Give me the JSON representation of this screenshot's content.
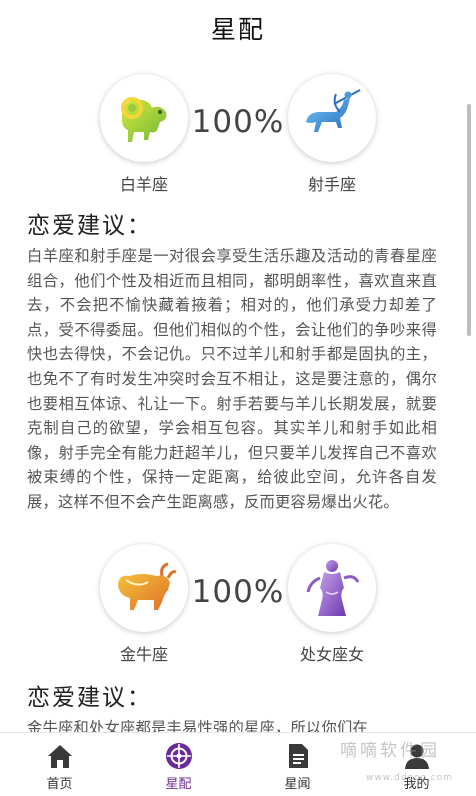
{
  "header": {
    "title": "星配"
  },
  "pairs": [
    {
      "left": {
        "name": "白羊座",
        "icon": "aries-ram-icon",
        "color": "#9acb3a"
      },
      "right": {
        "name": "射手座",
        "icon": "sagittarius-centaur-icon",
        "color": "#3a8fd0"
      },
      "percent": "100%",
      "advice_title": "恋爱建议：",
      "advice_text": "白羊座和射手座是一对很会享受生活乐趣及活动的青春星座组合，他们个性及相近而且相同，都明朗率性，喜欢直来直去，不会把不愉快藏着掖着；相对的，他们承受力却差了点，受不得委屈。但他们相似的个性，会让他们的争吵来得快也去得快，不会记仇。只不过羊儿和射手都是固执的主，也免不了有时发生冲突时会互不相让，这是要注意的，偶尔也要相互体谅、礼让一下。射手若要与羊儿长期发展，就要克制自己的欲望，学会相互包容。其实羊儿和射手如此相像，射手完全有能力赶超羊儿，但只要羊儿发挥自己不喜欢被束缚的个性，保持一定距离，给彼此空间，允许各自发展，这样不但不会产生距离感，反而更容易爆出火花。"
    },
    {
      "left": {
        "name": "金牛座",
        "icon": "taurus-bull-icon",
        "color": "#e8902a"
      },
      "right": {
        "name": "处女座女",
        "icon": "virgo-maiden-icon",
        "color": "#8a5cc4"
      },
      "percent": "100%",
      "advice_title": "恋爱建议：",
      "advice_text": "金牛座和处女座都是丰易性强的星座，所以你们在"
    }
  ],
  "tabs": [
    {
      "label": "首页",
      "icon": "home-icon",
      "active": false
    },
    {
      "label": "星配",
      "icon": "compass-icon",
      "active": true
    },
    {
      "label": "星闻",
      "icon": "document-icon",
      "active": false
    },
    {
      "label": "我的",
      "icon": "user-icon",
      "active": false
    }
  ],
  "watermark": {
    "text": "嘀嘀软件园",
    "sub": "www.ddooo.com"
  },
  "colors": {
    "accent": "#6a2a9a",
    "text": "#555555"
  }
}
